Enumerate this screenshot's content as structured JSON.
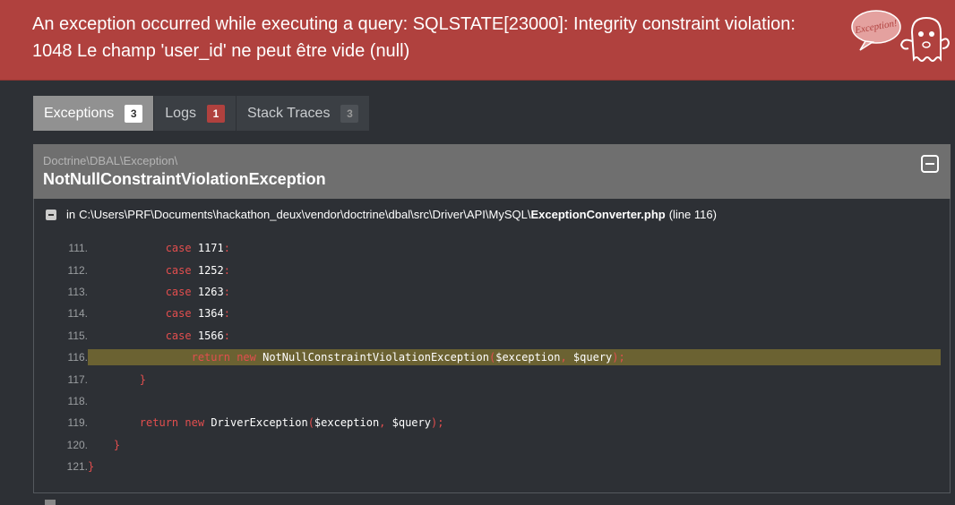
{
  "header": {
    "message": "An exception occurred while executing a query: SQLSTATE[23000]: Integrity constraint violation: 1048 Le champ 'user_id' ne peut être vide (null)",
    "ghost_caption": "Exception!"
  },
  "tabs": [
    {
      "label": "Exceptions",
      "count": "3"
    },
    {
      "label": "Logs",
      "count": "1"
    },
    {
      "label": "Stack Traces",
      "count": "3"
    }
  ],
  "exception": {
    "namespace": "Doctrine\\DBAL\\Exception\\",
    "class": "NotNullConstraintViolationException"
  },
  "trace": {
    "prefix": "in",
    "path": "C:\\Users\\PRF\\Documents\\hackathon_deux\\vendor\\doctrine\\dbal\\src\\Driver\\API\\MySQL\\",
    "filename": "ExceptionConverter.php",
    "line_info": "(line 116)"
  },
  "code_lines": [
    {
      "num": "111."
    },
    {
      "num": "112."
    },
    {
      "num": "113."
    },
    {
      "num": "114."
    },
    {
      "num": "115."
    },
    {
      "num": "116."
    },
    {
      "num": "117."
    },
    {
      "num": "118."
    },
    {
      "num": "119."
    },
    {
      "num": "120."
    },
    {
      "num": "121."
    }
  ],
  "code": {
    "case": "case",
    "n1171": "1171",
    "n1252": "1252",
    "n1263": "1263",
    "n1364": "1364",
    "n1566": "1566",
    "colon": ":",
    "return": "return",
    "new": "new",
    "exc_class": "NotNullConstraintViolationException",
    "driver_class": "DriverException",
    "var_exception": "$exception",
    "var_query": "$query",
    "open_paren": "(",
    "comma": ", ",
    "close_stmt": ");",
    "brace": "}"
  },
  "colors": {
    "header_bg": "#b0413e",
    "highlight_bg": "#6b6232",
    "keyword": "#e24e4e"
  }
}
